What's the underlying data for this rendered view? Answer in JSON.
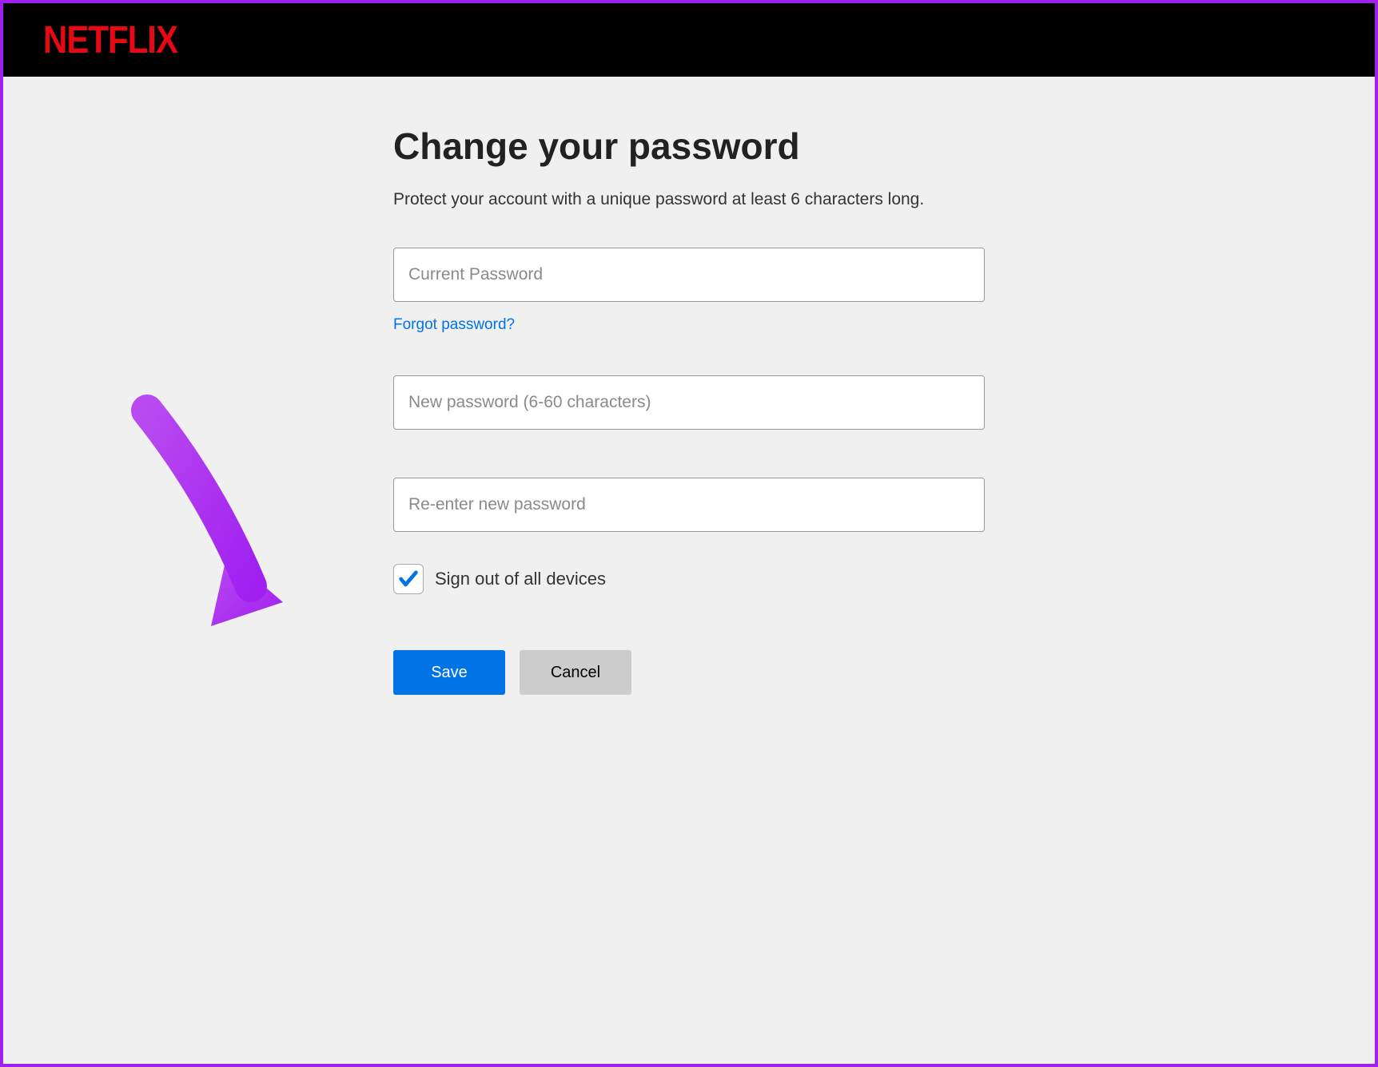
{
  "brand": "NETFLIX",
  "page": {
    "title": "Change your password",
    "subtitle": "Protect your account with a unique password at least 6 characters long."
  },
  "fields": {
    "current_placeholder": "Current Password",
    "new_placeholder": "New password (6-60 characters)",
    "confirm_placeholder": "Re-enter new password"
  },
  "links": {
    "forgot": "Forgot password?"
  },
  "checkbox": {
    "label": "Sign out of all devices",
    "checked": true
  },
  "buttons": {
    "save": "Save",
    "cancel": "Cancel"
  },
  "annotation": {
    "arrow_color": "#a020f0"
  }
}
